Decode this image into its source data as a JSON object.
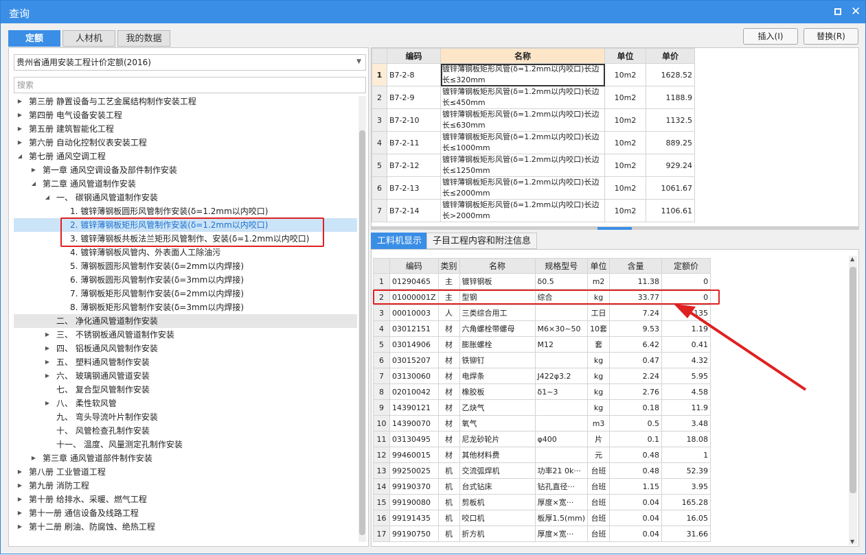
{
  "window": {
    "title": "查询",
    "restore_icon": "restore-icon",
    "close_glyph": "✕"
  },
  "tabs": [
    "定额",
    "人材机",
    "我的数据"
  ],
  "buttons": {
    "insert": "插入(I)",
    "replace": "替换(R)"
  },
  "left": {
    "combo": "贵州省通用安装工程计价定额(2016)",
    "search_placeholder": "搜索",
    "tree": [
      {
        "t": "第三册 静置设备与工艺金属结构制作安装工程",
        "lvl": 0,
        "exp": "c"
      },
      {
        "t": "第四册 电气设备安装工程",
        "lvl": 0,
        "exp": "c"
      },
      {
        "t": "第五册 建筑智能化工程",
        "lvl": 0,
        "exp": "c"
      },
      {
        "t": "第六册 自动化控制仪表安装工程",
        "lvl": 0,
        "exp": "c"
      },
      {
        "t": "第七册 通风空调工程",
        "lvl": 0,
        "exp": "e"
      },
      {
        "t": "第一章 通风空调设备及部件制作安装",
        "lvl": 1,
        "exp": "c"
      },
      {
        "t": "第二章 通风管道制作安装",
        "lvl": 1,
        "exp": "e"
      },
      {
        "t": "一、 碳钢通风管道制作安装",
        "lvl": 2,
        "exp": "e"
      },
      {
        "t": "1. 镀锌薄钢板圆形风管制作安装(δ=1.2mm以内咬口)",
        "lvl": 3,
        "exp": ""
      },
      {
        "t": "2. 镀锌薄钢板矩形风管制作安装(δ=1.2mm以内咬口)",
        "lvl": 3,
        "exp": "",
        "sel": true
      },
      {
        "t": "3. 镀锌薄钢板共板法兰矩形风管制作、安装(δ=1.2mm以内咬口)",
        "lvl": 3,
        "exp": ""
      },
      {
        "t": "4. 镀锌薄钢板风管内、外表面人工除油污",
        "lvl": 3,
        "exp": ""
      },
      {
        "t": "5. 薄钢板圆形风管制作安装(δ=2mm以内焊接)",
        "lvl": 3,
        "exp": ""
      },
      {
        "t": "6. 薄钢板圆形风管制作安装(δ=3mm以内焊接)",
        "lvl": 3,
        "exp": ""
      },
      {
        "t": "7. 薄钢板矩形风管制作安装(δ=2mm以内焊接)",
        "lvl": 3,
        "exp": ""
      },
      {
        "t": "8. 薄钢板矩形风管制作安装(δ=3mm以内焊接)",
        "lvl": 3,
        "exp": ""
      },
      {
        "t": "二、 净化通风管道制作安装",
        "lvl": 2,
        "exp": "",
        "gray": true
      },
      {
        "t": "三、 不锈钢板通风管道制作安装",
        "lvl": 2,
        "exp": "c"
      },
      {
        "t": "四、 铝板通风风管制作安装",
        "lvl": 2,
        "exp": "c"
      },
      {
        "t": "五、 塑料通风管制作安装",
        "lvl": 2,
        "exp": "c"
      },
      {
        "t": "六、 玻璃钢通风管道安装",
        "lvl": 2,
        "exp": "c"
      },
      {
        "t": "七、 复合型风管制作安装",
        "lvl": 2,
        "exp": ""
      },
      {
        "t": "八、 柔性软风管",
        "lvl": 2,
        "exp": "c"
      },
      {
        "t": "九、 弯头导流叶片制作安装",
        "lvl": 2,
        "exp": ""
      },
      {
        "t": "十、 风管检查孔制作安装",
        "lvl": 2,
        "exp": ""
      },
      {
        "t": "十一、 温度、风量测定孔制作安装",
        "lvl": 2,
        "exp": ""
      },
      {
        "t": "第三章 通风管道部件制作安装",
        "lvl": 1,
        "exp": "c"
      },
      {
        "t": "第八册 工业管道工程",
        "lvl": 0,
        "exp": "c"
      },
      {
        "t": "第九册 消防工程",
        "lvl": 0,
        "exp": "c"
      },
      {
        "t": "第十册 给排水、采暖、燃气工程",
        "lvl": 0,
        "exp": "c"
      },
      {
        "t": "第十一册 通信设备及线路工程",
        "lvl": 0,
        "exp": "c"
      },
      {
        "t": "第十二册 刷油、防腐蚀、绝热工程",
        "lvl": 0,
        "exp": "c"
      }
    ]
  },
  "quota_table": {
    "headers": [
      "",
      "编码",
      "名称",
      "单位",
      "单价"
    ],
    "rows": [
      [
        "1",
        "B7-2-8",
        "镀锌薄钢板矩形风管(δ=1.2mm以内咬口)长边长≤320mm",
        "10m2",
        "1628.52"
      ],
      [
        "2",
        "B7-2-9",
        "镀锌薄钢板矩形风管(δ=1.2mm以内咬口)长边长≤450mm",
        "10m2",
        "1188.9"
      ],
      [
        "3",
        "B7-2-10",
        "镀锌薄钢板矩形风管(δ=1.2mm以内咬口)长边长≤630mm",
        "10m2",
        "1132.5"
      ],
      [
        "4",
        "B7-2-11",
        "镀锌薄钢板矩形风管(δ=1.2mm以内咬口)长边长≤1000mm",
        "10m2",
        "889.25"
      ],
      [
        "5",
        "B7-2-12",
        "镀锌薄钢板矩形风管(δ=1.2mm以内咬口)长边长≤1250mm",
        "10m2",
        "929.24"
      ],
      [
        "6",
        "B7-2-13",
        "镀锌薄钢板矩形风管(δ=1.2mm以内咬口)长边长≤2000mm",
        "10m2",
        "1061.67"
      ],
      [
        "7",
        "B7-2-14",
        "镀锌薄钢板矩形风管(δ=1.2mm以内咬口)长边长>2000mm",
        "10m2",
        "1106.61"
      ]
    ]
  },
  "bottom_tabs": [
    "工料机显示",
    "子目工程内容和附注信息"
  ],
  "material_table": {
    "headers": [
      "",
      "编码",
      "类别",
      "名称",
      "规格型号",
      "单位",
      "含量",
      "定额价"
    ],
    "rows": [
      [
        "1",
        "01290465",
        "主",
        "镀锌钢板",
        "δ0.5",
        "m2",
        "11.38",
        "0"
      ],
      [
        "2",
        "01000001Z",
        "主",
        "型钢",
        "综合",
        "kg",
        "33.77",
        "0"
      ],
      [
        "3",
        "00010003",
        "人",
        "三类综合用工",
        "",
        "工日",
        "7.24",
        "135"
      ],
      [
        "4",
        "03012151",
        "材",
        "六角螺栓带螺母",
        "M6×30~50",
        "10套",
        "9.53",
        "1.19"
      ],
      [
        "5",
        "03014906",
        "材",
        "膨胀螺栓",
        "M12",
        "套",
        "6.42",
        "0.41"
      ],
      [
        "6",
        "03015207",
        "材",
        "铁铆钉",
        "",
        "kg",
        "0.47",
        "4.32"
      ],
      [
        "7",
        "03130060",
        "材",
        "电焊条",
        "J422φ3.2",
        "kg",
        "2.24",
        "5.95"
      ],
      [
        "8",
        "02010042",
        "材",
        "橡胶板",
        "δ1~3",
        "kg",
        "2.76",
        "4.58"
      ],
      [
        "9",
        "14390121",
        "材",
        "乙炔气",
        "",
        "kg",
        "0.18",
        "11.9"
      ],
      [
        "10",
        "14390070",
        "材",
        "氧气",
        "",
        "m3",
        "0.5",
        "3.48"
      ],
      [
        "11",
        "03130495",
        "材",
        "尼龙砂轮片",
        "φ400",
        "片",
        "0.1",
        "18.08"
      ],
      [
        "12",
        "99460015",
        "材",
        "其他材料费",
        "",
        "元",
        "0.48",
        "1"
      ],
      [
        "13",
        "99250025",
        "机",
        "交流弧焊机",
        "功率21 0k···",
        "台班",
        "0.48",
        "52.39"
      ],
      [
        "14",
        "99190370",
        "机",
        "台式钻床",
        "钻孔直径···",
        "台班",
        "1.15",
        "3.95"
      ],
      [
        "15",
        "99190080",
        "机",
        "剪板机",
        "厚度×宽···",
        "台班",
        "0.04",
        "165.28"
      ],
      [
        "16",
        "99191435",
        "机",
        "咬口机",
        "板厚1.5(mm)",
        "台班",
        "0.04",
        "16.05"
      ],
      [
        "17",
        "99190750",
        "机",
        "折方机",
        "厚度×宽···",
        "台班",
        "0.04",
        "31.66"
      ]
    ]
  },
  "colors": {
    "accent": "#3a8ee6",
    "highlight": "#e02020",
    "selected_row": "#cce4f7"
  }
}
